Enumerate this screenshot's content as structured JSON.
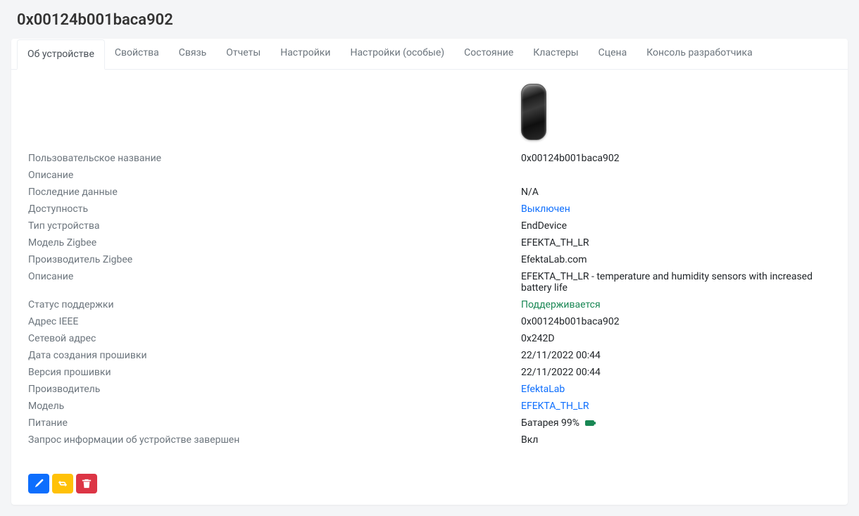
{
  "page": {
    "title": "0x00124b001baca902"
  },
  "tabs": {
    "about": "Об устройстве",
    "props": "Свойства",
    "bind": "Связь",
    "reports": "Отчеты",
    "settings": "Настройки",
    "settings_specific": "Настройки (особые)",
    "state": "Состояние",
    "clusters": "Кластеры",
    "scene": "Сцена",
    "devconsole": "Консоль разработчика"
  },
  "labels": {
    "friendly_name": "Пользовательское название",
    "description1": "Описание",
    "last_seen": "Последние данные",
    "availability": "Доступность",
    "device_type": "Тип устройства",
    "zigbee_model": "Модель Zigbee",
    "zigbee_manufacturer": "Производитель Zigbee",
    "description2": "Описание",
    "support_status": "Статус поддержки",
    "ieee": "Адрес IEEE",
    "nwk": "Сетевой адрес",
    "fw_date": "Дата создания прошивки",
    "fw_version": "Версия прошивки",
    "manufacturer": "Производитель",
    "model": "Модель",
    "power": "Питание",
    "interview_done": "Запрос информации об устройстве завершен"
  },
  "values": {
    "friendly_name": "0x00124b001baca902",
    "description1": "",
    "last_seen": "N/A",
    "availability": "Выключен",
    "device_type": "EndDevice",
    "zigbee_model": "EFEKTA_TH_LR",
    "zigbee_manufacturer": "EfektaLab.com",
    "description2": "EFEKTA_TH_LR - temperature and humidity sensors with increased battery life",
    "support_status": "Поддерживается",
    "ieee": "0x00124b001baca902",
    "nwk": "0x242D",
    "fw_date": "22/11/2022 00:44",
    "fw_version": "22/11/2022 00:44",
    "manufacturer": "EfektaLab",
    "model": "EFEKTA_TH_LR",
    "power": "Батарея 99%",
    "interview_done": "Вкл"
  },
  "actions": {
    "rename": "rename",
    "reconfigure": "reconfigure",
    "delete": "delete"
  }
}
